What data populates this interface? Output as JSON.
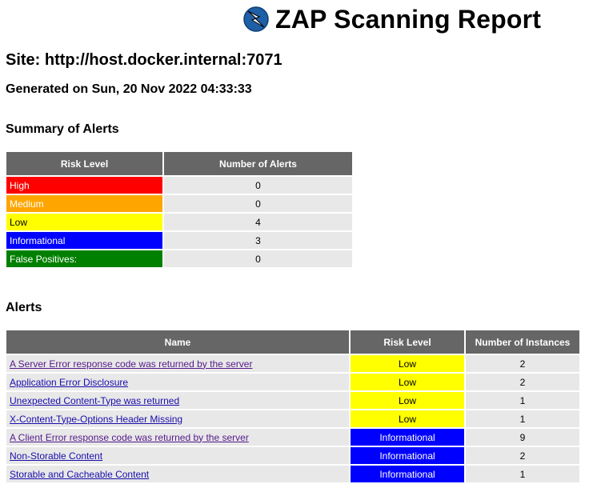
{
  "header": {
    "title": "ZAP Scanning Report",
    "logo": "zap-lightning-icon"
  },
  "site": "Site: http://host.docker.internal:7071",
  "generated": "Generated on Sun, 20 Nov 2022 04:33:33",
  "summary": {
    "heading": "Summary of Alerts",
    "columns": [
      "Risk Level",
      "Number of Alerts"
    ],
    "rows": [
      {
        "level": "High",
        "count": "0",
        "color": "#ff0000"
      },
      {
        "level": "Medium",
        "count": "0",
        "color": "#ffa500"
      },
      {
        "level": "Low",
        "count": "4",
        "color": "#ffff00"
      },
      {
        "level": "Informational",
        "count": "3",
        "color": "#0000ff"
      },
      {
        "level": "False Positives:",
        "count": "0",
        "color": "#008000"
      }
    ]
  },
  "alerts": {
    "heading": "Alerts",
    "columns": [
      "Name",
      "Risk Level",
      "Number of Instances"
    ],
    "rows": [
      {
        "name": "A Server Error response code was returned by the server",
        "risk": "Low",
        "instances": "2"
      },
      {
        "name": "Application Error Disclosure",
        "risk": "Low",
        "instances": "2"
      },
      {
        "name": "Unexpected Content-Type was returned",
        "risk": "Low",
        "instances": "1"
      },
      {
        "name": "X-Content-Type-Options Header Missing",
        "risk": "Low",
        "instances": "1"
      },
      {
        "name": "A Client Error response code was returned by the server",
        "risk": "Informational",
        "instances": "9"
      },
      {
        "name": "Non-Storable Content",
        "risk": "Informational",
        "instances": "2"
      },
      {
        "name": "Storable and Cacheable Content",
        "risk": "Informational",
        "instances": "1"
      }
    ]
  }
}
